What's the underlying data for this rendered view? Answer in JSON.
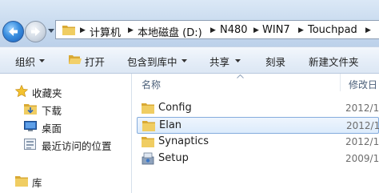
{
  "address": {
    "breadcrumbs": [
      "计算机",
      "本地磁盘 (D:)",
      "N480",
      "WIN7",
      "Touchpad"
    ]
  },
  "toolbar": {
    "organize_label": "组织",
    "open_label": "打开",
    "include_label": "包含到库中",
    "share_label": "共享",
    "burn_label": "刻录",
    "new_folder_label": "新建文件夹"
  },
  "sidebar": {
    "favorites_label": "收藏夹",
    "items": [
      {
        "label": "下载",
        "icon": "download-folder-icon"
      },
      {
        "label": "桌面",
        "icon": "desktop-icon"
      },
      {
        "label": "最近访问的位置",
        "icon": "recent-places-icon"
      }
    ],
    "libraries_label": "库"
  },
  "filelist": {
    "columns": {
      "name": "名称",
      "modified": "修改日"
    },
    "rows": [
      {
        "name": "Config",
        "date": "2012/1",
        "type": "folder",
        "selected": false
      },
      {
        "name": "Elan",
        "date": "2012/1",
        "type": "folder",
        "selected": true
      },
      {
        "name": "Synaptics",
        "date": "2012/1",
        "type": "folder",
        "selected": false
      },
      {
        "name": "Setup",
        "date": "2009/1",
        "type": "setup",
        "selected": false
      }
    ]
  },
  "colors": {
    "selection_border": "#84acdd",
    "toolbar_bg": "#e6eef8",
    "folder": "#e8c25a"
  }
}
